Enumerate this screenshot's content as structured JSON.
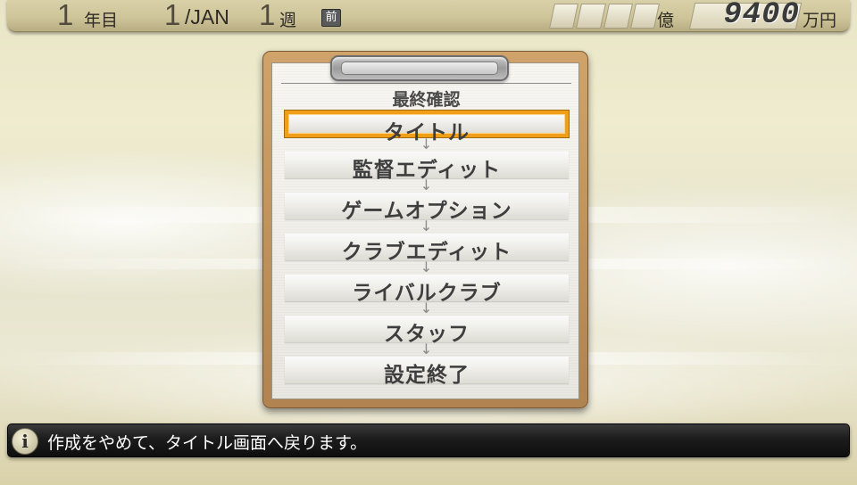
{
  "status_bar": {
    "year_number": "1",
    "year_label": "年目",
    "month_number": "1",
    "month_label": "/JAN",
    "week_number": "1",
    "week_label": "週",
    "season_badge": "前",
    "money_unit_oku": "億",
    "money_value": "9400",
    "money_unit": "万円"
  },
  "final_check_menu": {
    "title": "最終確認",
    "steps": [
      {
        "label": "タイトル",
        "selected": true
      },
      {
        "label": "監督エディット",
        "selected": false
      },
      {
        "label": "ゲームオプション",
        "selected": false
      },
      {
        "label": "クラブエディット",
        "selected": false
      },
      {
        "label": "ライバルクラブ",
        "selected": false
      },
      {
        "label": "スタッフ",
        "selected": false
      },
      {
        "label": "設定終了",
        "selected": false
      }
    ],
    "arrow_icon": "down-arrow-icon"
  },
  "info_bar": {
    "icon": "info-icon",
    "icon_glyph": "i",
    "message": "作成をやめて、タイトル画面へ戻ります。"
  },
  "colors": {
    "selection_border": "#f19f17",
    "clipboard_board": "#c0935b",
    "info_bar_bg": "#1c1c1c"
  }
}
